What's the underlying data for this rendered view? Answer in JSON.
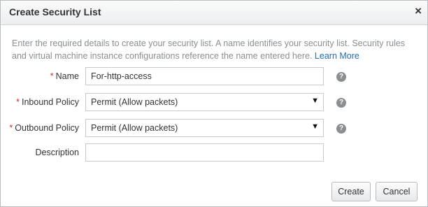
{
  "dialog": {
    "title": "Create Security List",
    "close_icon": "×",
    "intro_text": "Enter the required details to create your security list. A name identifies your security list. Security rules and virtual machine instance configurations reference the name entered here.",
    "learn_more": "Learn More"
  },
  "form": {
    "required_marker": "*",
    "name": {
      "label": "Name",
      "value": "For-http-access",
      "help": "?"
    },
    "inbound": {
      "label": "Inbound Policy",
      "value": "Permit (Allow packets)",
      "caret": "▼",
      "help": "?"
    },
    "outbound": {
      "label": "Outbound Policy",
      "value": "Permit (Allow packets)",
      "caret": "▼",
      "help": "?"
    },
    "description": {
      "label": "Description",
      "value": ""
    }
  },
  "buttons": {
    "create": "Create",
    "cancel": "Cancel"
  }
}
